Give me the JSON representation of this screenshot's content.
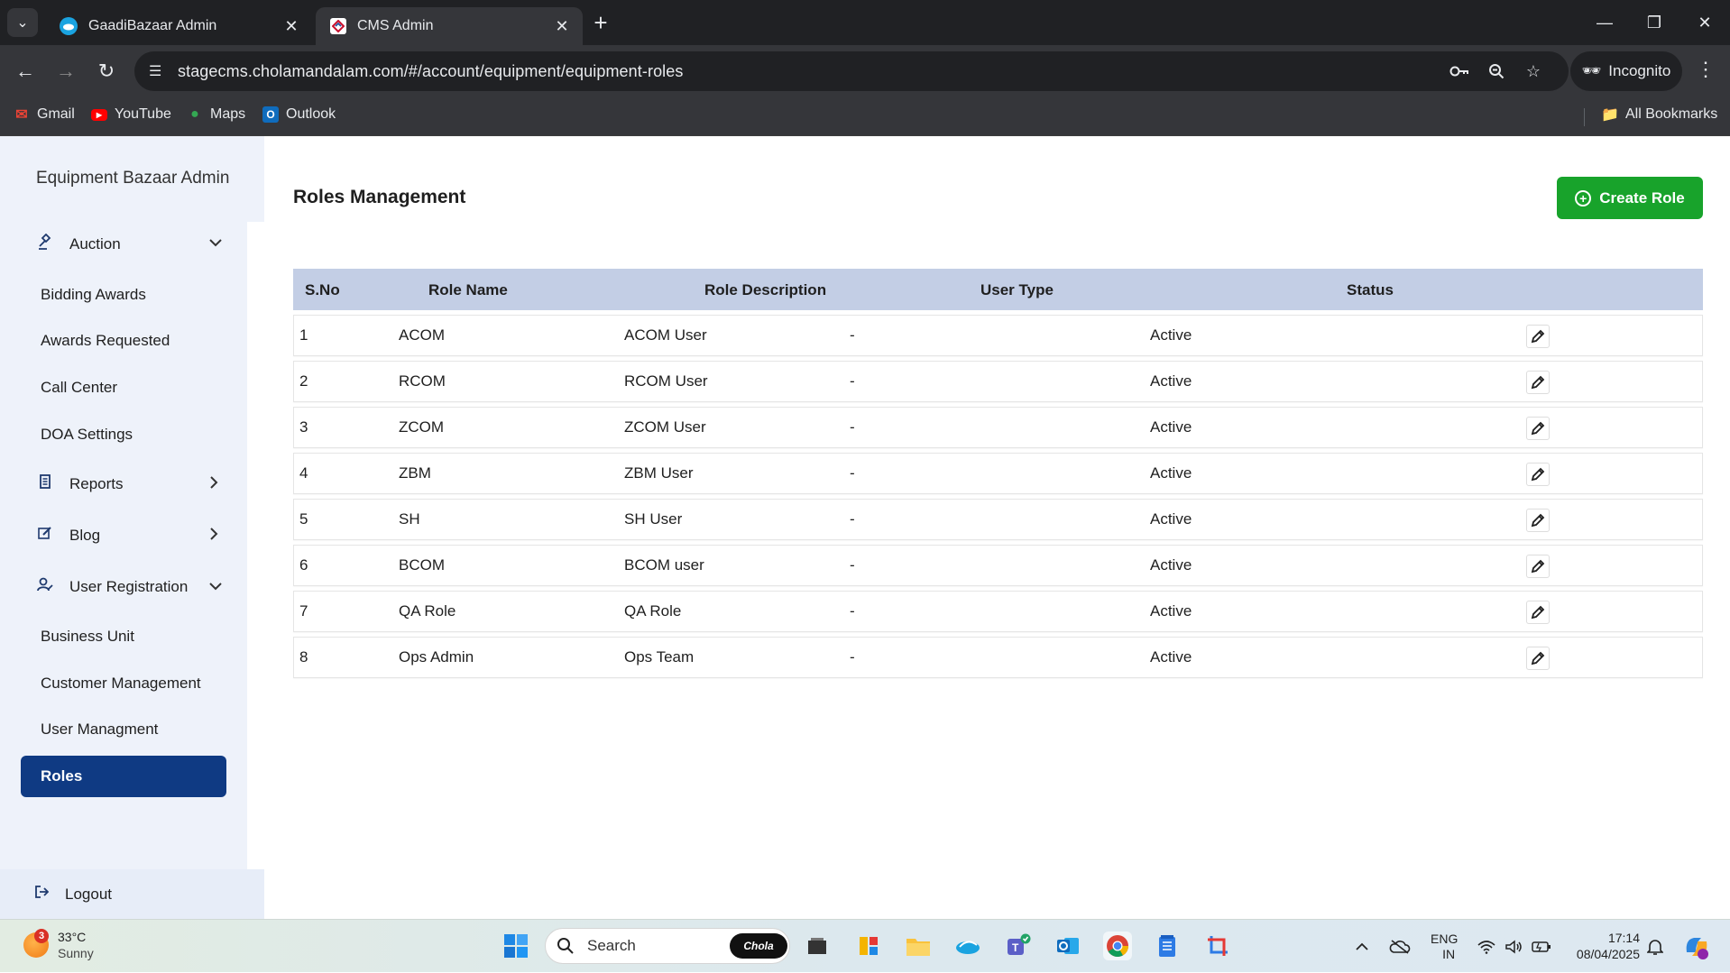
{
  "browser": {
    "tabs": [
      {
        "title": "GaadiBazaar Admin",
        "active": false
      },
      {
        "title": "CMS Admin",
        "active": true
      }
    ],
    "url": "stagecms.cholamandalam.com/#/account/equipment/equipment-roles",
    "incognito_label": "Incognito",
    "bookmarks": [
      "Gmail",
      "YouTube",
      "Maps",
      "Outlook"
    ],
    "all_bookmarks_label": "All Bookmarks"
  },
  "sidebar": {
    "brand": "Equipment Bazaar Admin",
    "auction": "Auction",
    "auction_items": [
      "Bidding Awards",
      "Awards Requested",
      "Call Center",
      "DOA Settings"
    ],
    "reports": "Reports",
    "blog": "Blog",
    "user_registration": "User Registration",
    "registration_items": [
      "Business Unit",
      "Customer Management",
      "User Managment"
    ],
    "active_item": "Roles",
    "logout": "Logout"
  },
  "main": {
    "title": "Roles Management",
    "create_button": "Create Role",
    "columns": [
      "S.No",
      "Role Name",
      "Role Description",
      "User Type",
      "Status"
    ],
    "rows": [
      {
        "sno": "1",
        "name": "ACOM",
        "description": "ACOM User",
        "user_type": "-",
        "status": "Active"
      },
      {
        "sno": "2",
        "name": "RCOM",
        "description": "RCOM User",
        "user_type": "-",
        "status": "Active"
      },
      {
        "sno": "3",
        "name": "ZCOM",
        "description": "ZCOM User",
        "user_type": "-",
        "status": "Active"
      },
      {
        "sno": "4",
        "name": "ZBM",
        "description": "ZBM User",
        "user_type": "-",
        "status": "Active"
      },
      {
        "sno": "5",
        "name": "SH",
        "description": "SH User",
        "user_type": "-",
        "status": "Active"
      },
      {
        "sno": "6",
        "name": "BCOM",
        "description": "BCOM user",
        "user_type": "-",
        "status": "Active"
      },
      {
        "sno": "7",
        "name": "QA Role",
        "description": "QA Role",
        "user_type": "-",
        "status": "Active"
      },
      {
        "sno": "8",
        "name": "Ops Admin",
        "description": "Ops Team",
        "user_type": "-",
        "status": "Active"
      }
    ]
  },
  "taskbar": {
    "weather_badge": "3",
    "temperature": "33°C",
    "condition": "Sunny",
    "search_placeholder": "Search",
    "search_badge": "Chola",
    "lang_top": "ENG",
    "lang_bottom": "IN",
    "time": "17:14",
    "date": "08/04/2025"
  },
  "colors": {
    "sidebar_bg": "#eef2fa",
    "active_nav": "#0f3a83",
    "create_button": "#18a32b",
    "table_header": "#c3cee5"
  }
}
